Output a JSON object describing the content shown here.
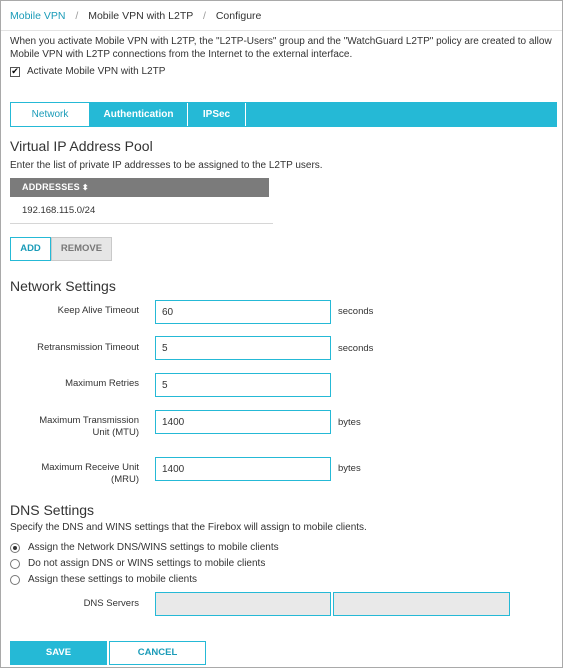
{
  "breadcrumb": {
    "items": [
      "Mobile VPN",
      "Mobile VPN with L2TP",
      "Configure"
    ]
  },
  "intro_text": "When you activate Mobile VPN with L2TP, the \"L2TP-Users\" group and the \"WatchGuard L2TP\" policy are created to allow Mobile VPN with L2TP connections from the Internet to the external interface.",
  "activate": {
    "label": "Activate Mobile VPN with L2TP",
    "checked": true,
    "check_glyph": "✔"
  },
  "tabs": [
    {
      "label": "Network",
      "active": true
    },
    {
      "label": "Authentication",
      "active": false
    },
    {
      "label": "IPSec",
      "active": false
    }
  ],
  "ip_pool": {
    "title": "Virtual IP Address Pool",
    "description": "Enter the list of private IP addresses to be assigned to the L2TP users.",
    "column_header": "ADDRESSES",
    "sort_glyph": "⬍",
    "rows": [
      "192.168.115.0/24"
    ],
    "add_label": "ADD",
    "remove_label": "REMOVE"
  },
  "network_settings": {
    "title": "Network Settings",
    "keep_alive": {
      "label": "Keep Alive Timeout",
      "value": "60",
      "unit": "seconds"
    },
    "retransmission": {
      "label": "Retransmission Timeout",
      "value": "5",
      "unit": "seconds"
    },
    "max_retries": {
      "label": "Maximum Retries",
      "value": "5"
    },
    "mtu": {
      "label_line1": "Maximum Transmission",
      "label_line2": "Unit (MTU)",
      "value": "1400",
      "unit": "bytes"
    },
    "mru": {
      "label_line1": "Maximum Receive Unit",
      "label_line2": "(MRU)",
      "value": "1400",
      "unit": "bytes"
    }
  },
  "dns_settings": {
    "title": "DNS Settings",
    "description": "Specify the DNS and WINS settings that the Firebox will assign to mobile clients.",
    "options": [
      {
        "label": "Assign the Network DNS/WINS settings to mobile clients",
        "selected": true
      },
      {
        "label": "Do not assign DNS or WINS settings to mobile clients",
        "selected": false
      },
      {
        "label": "Assign these settings to mobile clients",
        "selected": false
      }
    ],
    "dns_servers_label": "DNS Servers"
  },
  "footer": {
    "save_label": "SAVE",
    "cancel_label": "CANCEL"
  },
  "colors": {
    "accent": "#25b9d6",
    "link": "#1a9bb8",
    "table_header": "#7b7b7b"
  }
}
